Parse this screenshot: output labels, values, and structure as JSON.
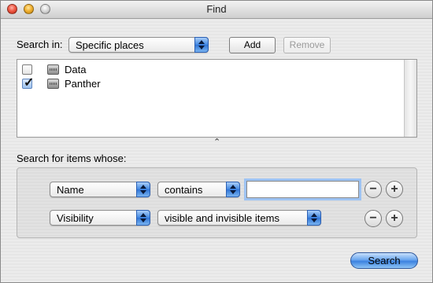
{
  "window": {
    "title": "Find"
  },
  "search_in": {
    "label": "Search in:",
    "selected": "Specific places",
    "add_label": "Add",
    "remove_label": "Remove"
  },
  "places": [
    {
      "label": "Data",
      "checked": false
    },
    {
      "label": "Panther",
      "checked": true
    }
  ],
  "criteria": {
    "label": "Search for items whose:",
    "rows": [
      {
        "attribute": "Name",
        "operator": "contains",
        "value": ""
      },
      {
        "attribute": "Visibility",
        "operator": "visible and invisible items"
      }
    ]
  },
  "search_button": {
    "label": "Search"
  },
  "icons": {
    "resize_grip": "resize-grip-icon",
    "drive": "hard-drive-icon",
    "remove_row": "minus-icon",
    "add_row": "plus-icon"
  }
}
